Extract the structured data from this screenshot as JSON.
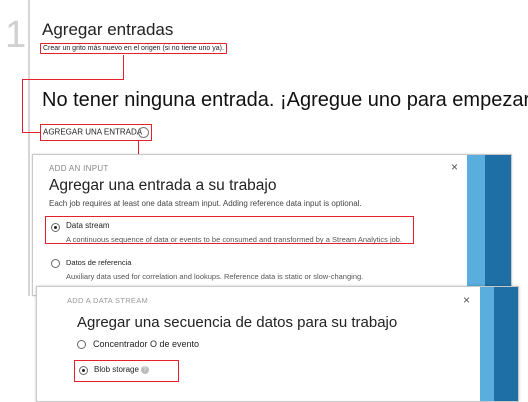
{
  "step": {
    "number": "1",
    "title": "Agregar entradas",
    "subtitle": "Crear un grito más nuevo en el origen (si no tiene uno ya).",
    "empty_message": "No tener ninguna entrada. ¡Agregue uno para empezar!",
    "add_button": "AGREGAR UNA ENTRADA"
  },
  "add_input_panel": {
    "header": "ADD AN INPUT",
    "title": "Agregar una entrada a su trabajo",
    "description": "Each job requires at least one data stream input. Adding reference data input is optional.",
    "options": [
      {
        "label": "Data stream",
        "description": "A continuous sequence of data or events to be consumed and transformed by a Stream Analytics job.",
        "selected": true
      },
      {
        "label": "Datos de referencia",
        "description": "Auxiliary data used for correlation and lookups. Reference data is static or slow-changing.",
        "selected": false
      }
    ],
    "close": "×"
  },
  "add_stream_panel": {
    "header": "ADD A DATA STREAM",
    "title": "Agregar una secuencia de datos para su trabajo",
    "options": [
      {
        "label": "Concentrador O de evento",
        "selected": false
      },
      {
        "label": "Blob storage",
        "selected": true
      }
    ],
    "close": "×",
    "help": "?"
  },
  "colors": {
    "highlight": "#e2212c",
    "accent_dark": "#1d6fa5",
    "accent_light": "#5aaede"
  }
}
